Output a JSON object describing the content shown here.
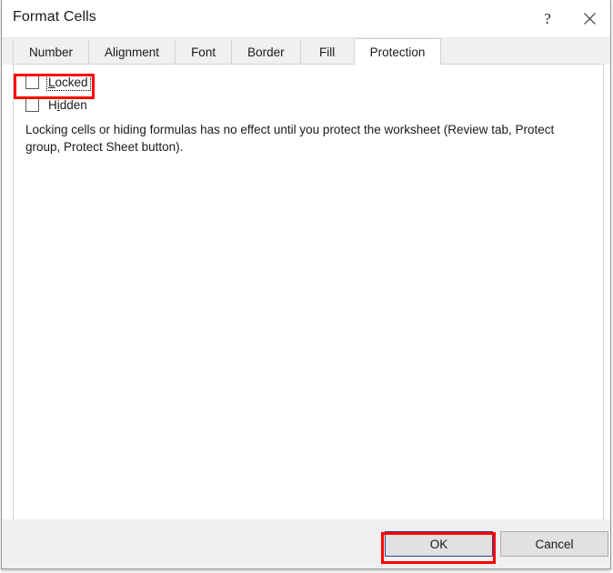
{
  "dialog": {
    "title": "Format Cells",
    "titlebar_buttons": [
      {
        "name": "help",
        "glyph": "?"
      },
      {
        "name": "close",
        "glyph": "✕"
      }
    ]
  },
  "tabs": [
    {
      "label": "Number",
      "active": false
    },
    {
      "label": "Alignment",
      "active": false
    },
    {
      "label": "Font",
      "active": false
    },
    {
      "label": "Border",
      "active": false
    },
    {
      "label": "Fill",
      "active": false
    },
    {
      "label": "Protection",
      "active": true
    }
  ],
  "protection": {
    "locked": {
      "label_prefix": "",
      "accel": "L",
      "label_suffix": "ocked",
      "checked": false,
      "focused": true
    },
    "hidden": {
      "label_prefix": "H",
      "accel": "i",
      "label_suffix": "dden",
      "checked": false,
      "focused": false
    },
    "description": "Locking cells or hiding formulas has no effect until you protect the worksheet (Review tab, Protect group, Protect Sheet button)."
  },
  "footer": {
    "ok_label": "OK",
    "cancel_label": "Cancel"
  },
  "annotations": {
    "color": "#FF0000",
    "targets": [
      "locked-checkbox",
      "ok-button"
    ]
  }
}
